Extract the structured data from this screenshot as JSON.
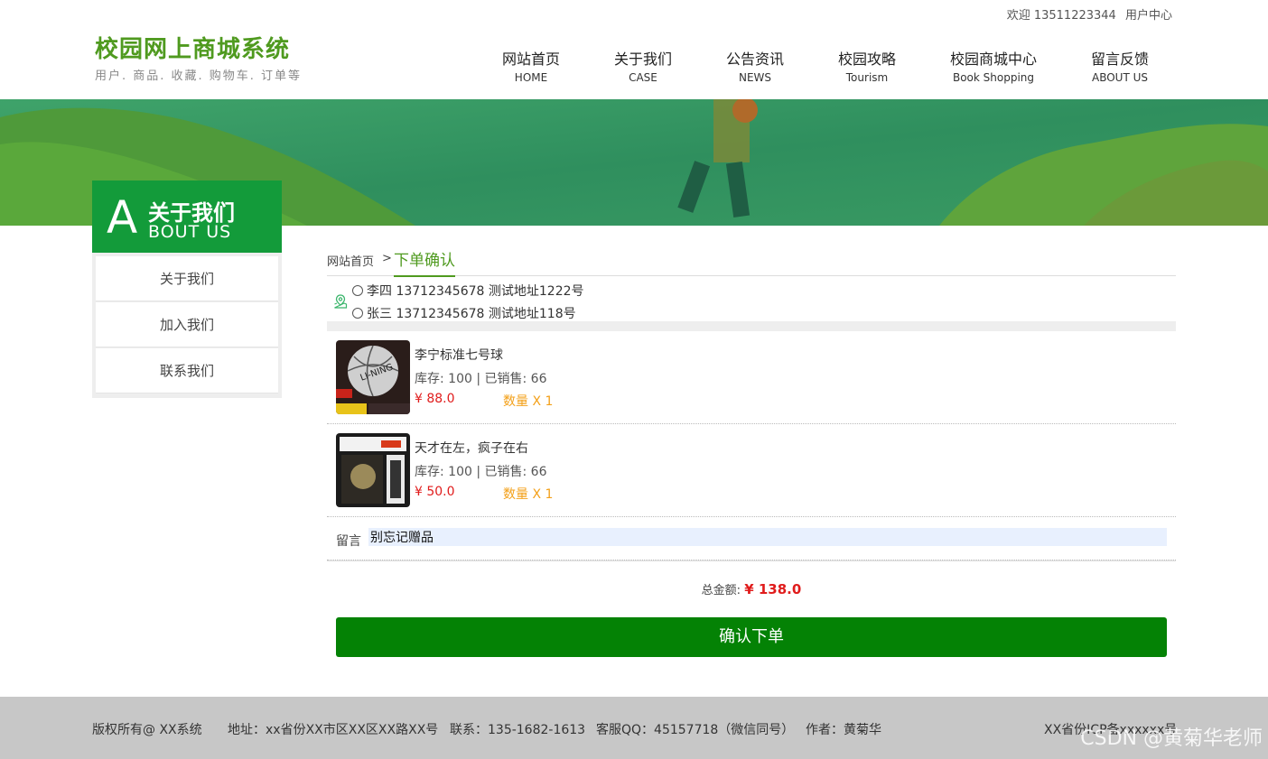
{
  "header": {
    "welcome": "欢迎 13511223344",
    "user_center": "用户中心",
    "site_title": "校园网上商城系统",
    "site_subtitle": "用户. 商品. 收藏. 购物车. 订单等",
    "nav": [
      {
        "cn": "网站首页",
        "en": "HOME"
      },
      {
        "cn": "关于我们",
        "en": "CASE"
      },
      {
        "cn": "公告资讯",
        "en": "NEWS"
      },
      {
        "cn": "校园攻略",
        "en": "Tourism"
      },
      {
        "cn": "校园商城中心",
        "en": "Book Shopping"
      },
      {
        "cn": "留言反馈",
        "en": "ABOUT US"
      }
    ]
  },
  "sidebar": {
    "head_letter": "A",
    "head_cn": "关于我们",
    "head_en": "BOUT  US",
    "items": [
      "关于我们",
      "加入我们",
      "联系我们"
    ]
  },
  "breadcrumb": {
    "home": "网站首页",
    "sep": ">",
    "current": "下单确认"
  },
  "addresses": [
    "李四 13712345678 测试地址1222号",
    "张三 13712345678 测试地址118号"
  ],
  "products": [
    {
      "name": "李宁标准七号球",
      "stock": "库存:   100 | 已销售:   66",
      "price": "¥ 88.0",
      "qty": "数量 X 1"
    },
    {
      "name": "天才在左，疯子在右",
      "stock": "库存:   100 | 已销售:   66",
      "price": "¥ 50.0",
      "qty": "数量 X 1"
    }
  ],
  "message": {
    "label": "留言",
    "value": "别忘记赠品"
  },
  "total": {
    "label": "总金额:",
    "amount": "¥ 138.0"
  },
  "confirm_label": "确认下单",
  "footer": {
    "copyright": "版权所有@    XX系统",
    "address": "地址：xx省份XX市区XX区XX路XX号",
    "phone": "联系：135-1682-1613",
    "qq": "客服QQ：45157718（微信同号）",
    "author": "作者：黄菊华",
    "icp": "XX省份ICP备xxxxxx号",
    "watermark": "CSDN @黄菊华老师"
  },
  "colors": {
    "brand_green": "#4f9a1f",
    "side_green": "#139b3a",
    "button_green": "#048205",
    "price_red": "#e01c1c",
    "qty_orange": "#f3a019",
    "footer_gray": "#c7c7c7"
  }
}
